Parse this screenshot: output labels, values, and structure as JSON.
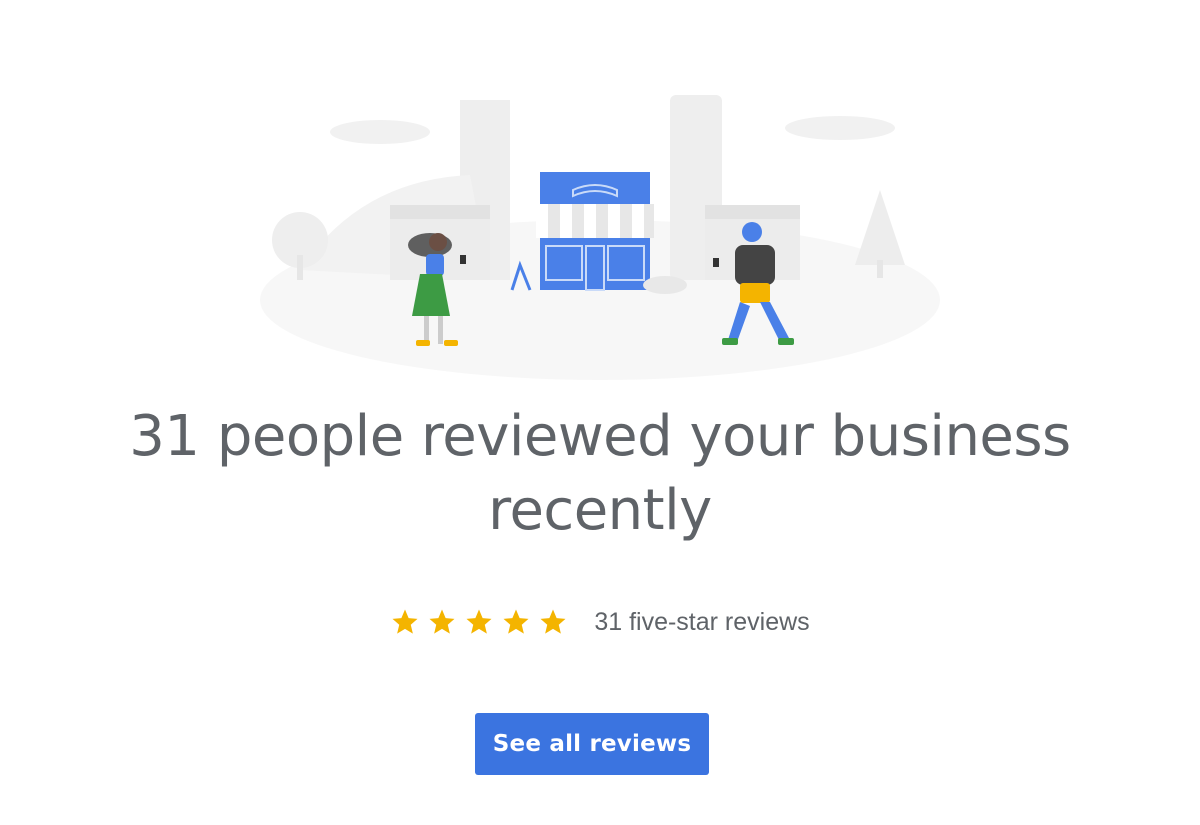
{
  "headline": {
    "line1": "31 people reviewed your business",
    "line2": "recently"
  },
  "rating": {
    "star_count": 5,
    "summary": "31 five-star reviews"
  },
  "cta": {
    "label": "See all reviews"
  },
  "colors": {
    "text": "#5f6368",
    "star": "#f4b400",
    "button": "#3b74e0",
    "shop_blue": "#4a80e8"
  },
  "icons": {
    "star": "star-icon"
  }
}
